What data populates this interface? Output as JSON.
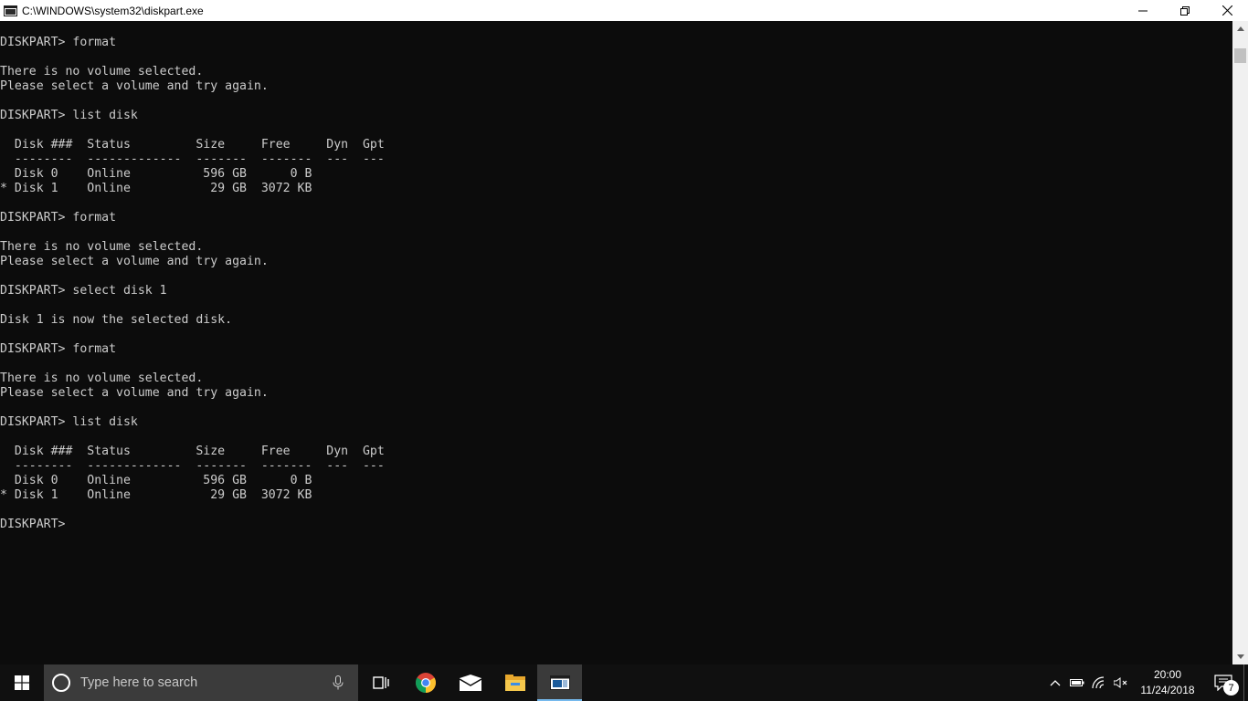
{
  "window": {
    "title": "C:\\WINDOWS\\system32\\diskpart.exe",
    "icon": "console-icon",
    "controls": [
      "minimize-icon",
      "restore-icon",
      "close-icon"
    ]
  },
  "console": {
    "lines": [
      "DISKPART> format",
      "",
      "There is no volume selected.",
      "Please select a volume and try again.",
      "",
      "DISKPART> list disk",
      "",
      "  Disk ###  Status         Size     Free     Dyn  Gpt",
      "  --------  -------------  -------  -------  ---  ---",
      "  Disk 0    Online          596 GB      0 B",
      "* Disk 1    Online           29 GB  3072 KB",
      "",
      "DISKPART> format",
      "",
      "There is no volume selected.",
      "Please select a volume and try again.",
      "",
      "DISKPART> select disk 1",
      "",
      "Disk 1 is now the selected disk.",
      "",
      "DISKPART> format",
      "",
      "There is no volume selected.",
      "Please select a volume and try again.",
      "",
      "DISKPART> list disk",
      "",
      "  Disk ###  Status         Size     Free     Dyn  Gpt",
      "  --------  -------------  -------  -------  ---  ---",
      "  Disk 0    Online          596 GB      0 B",
      "* Disk 1    Online           29 GB  3072 KB",
      "",
      "DISKPART> "
    ]
  },
  "taskbar": {
    "search_placeholder": "Type here to search",
    "apps": [
      "task-view-icon",
      "chrome-icon",
      "mail-icon",
      "file-explorer-icon",
      "diskpart-console-icon"
    ],
    "clock_time": "20:00",
    "clock_date": "11/24/2018",
    "notification_count": "7",
    "tray_icons": [
      "chevron-up-icon",
      "battery-icon",
      "wifi-icon",
      "volume-muted-icon"
    ]
  },
  "colors": {
    "console_bg": "#0c0c0c",
    "console_text": "#cccccc",
    "taskbar_bg": "#101010",
    "search_bg": "#3b3b3b",
    "active_indicator": "#76b9ed"
  }
}
